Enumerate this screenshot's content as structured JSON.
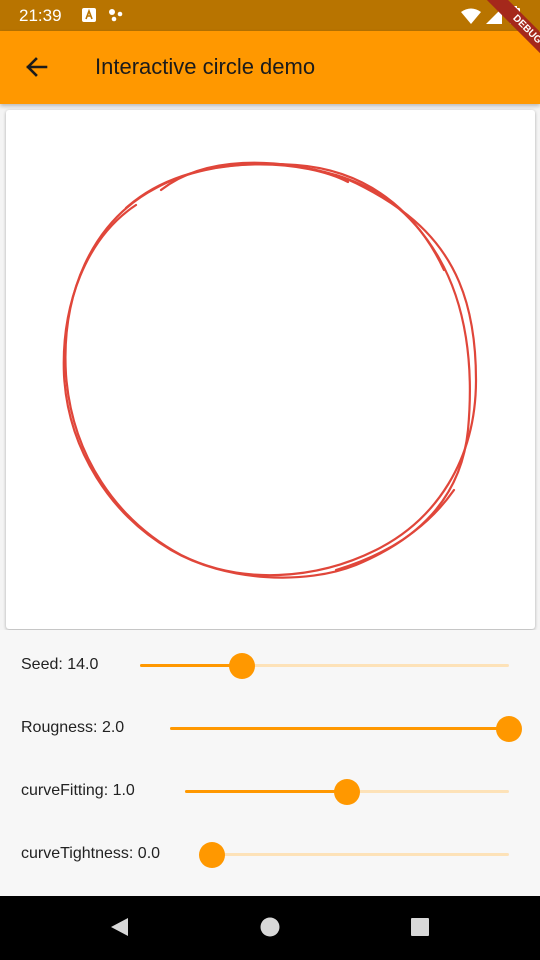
{
  "status_bar": {
    "time": "21:39"
  },
  "app_bar": {
    "title": "Interactive circle demo"
  },
  "debug_banner": {
    "label": "DEBUG"
  },
  "canvas": {
    "stroke_color": "#e0463a"
  },
  "controls": [
    {
      "label": "Seed: 14.0",
      "fraction": 0.276
    },
    {
      "label": "Rougness: 2.0",
      "fraction": 1.0
    },
    {
      "label": "curveFitting: 1.0",
      "fraction": 0.5
    },
    {
      "label": "curveTightness: 0.0",
      "fraction": 0.0
    }
  ],
  "colors": {
    "accent": "#ff9800",
    "status_bar": "#b87400",
    "track_inactive": "#fde2b8"
  },
  "icons": {
    "back": "arrow-left-icon",
    "nav_back": "triangle-back-icon",
    "nav_home": "circle-home-icon",
    "nav_recents": "square-recents-icon"
  }
}
